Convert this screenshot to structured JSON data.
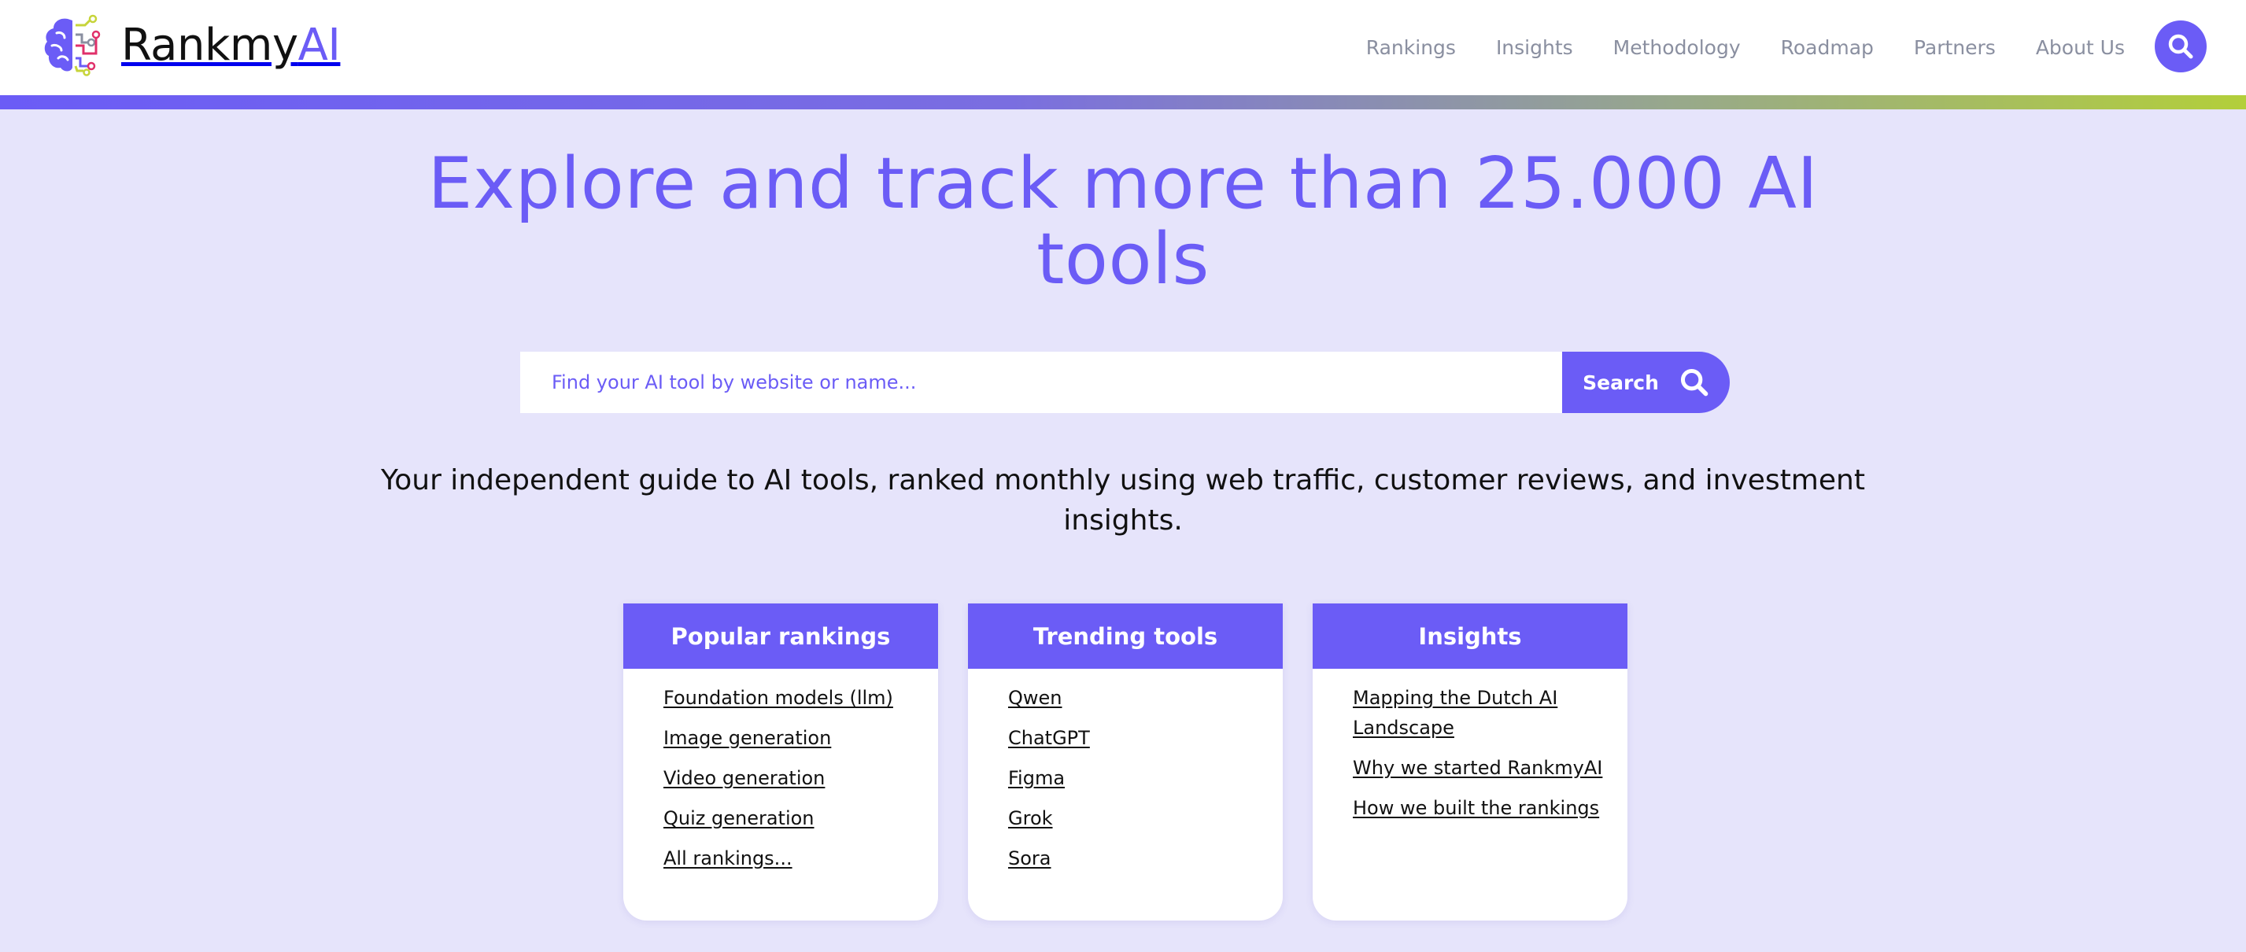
{
  "brand": {
    "name_part1": "Rankmy",
    "name_part2": "AI"
  },
  "nav": {
    "items": [
      "Rankings",
      "Insights",
      "Methodology",
      "Roadmap",
      "Partners",
      "About Us"
    ]
  },
  "hero": {
    "title": "Explore and track more than 25.000 AI tools",
    "search_placeholder": "Find your AI tool by website or name...",
    "search_button": "Search",
    "tagline": "Your independent guide to AI tools, ranked monthly using  web traffic, customer reviews, and investment insights."
  },
  "cards": [
    {
      "title": "Popular rankings",
      "links": [
        "Foundation models (llm)",
        "Image generation",
        "Video generation",
        "Quiz generation",
        "All rankings..."
      ]
    },
    {
      "title": "Trending tools",
      "links": [
        "Qwen",
        "ChatGPT",
        "Figma",
        "Grok",
        "Sora"
      ]
    },
    {
      "title": "Insights",
      "links": [
        "Mapping the Dutch AI Landscape",
        "Why we started RankmyAI",
        "How we built the rankings"
      ]
    }
  ],
  "icons": {
    "logo": "brain-circuit-icon",
    "search": "search-icon"
  },
  "colors": {
    "primary": "#6b5cf6",
    "background": "#e6e4fb",
    "stripe_end": "#b3cf3a"
  }
}
